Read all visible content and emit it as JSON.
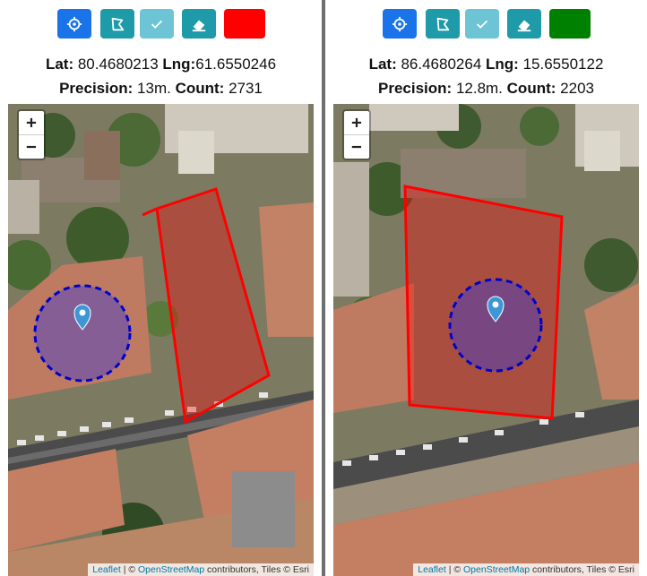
{
  "panels": [
    {
      "lat_label": "Lat:",
      "lat": "80.4680213",
      "lng_label": "Lng:",
      "lng": "61.6550246",
      "precision_label": "Precision:",
      "precision": "13m.",
      "count_label": "Count:",
      "count": "2731",
      "color_swatch": "#ff0000"
    },
    {
      "lat_label": "Lat:",
      "lat": "86.4680264",
      "lng_label": "Lng:",
      "lng": "15.6550122",
      "precision_label": "Precision:",
      "precision": "12.8m.",
      "count_label": "Count:",
      "count": "2203",
      "color_swatch": "#008000"
    }
  ],
  "toolbar": {
    "buttons": [
      {
        "icon": "crosshair-icon",
        "color": "#1a73e8"
      },
      {
        "icon": "polygon-draw-icon",
        "color": "#1e9aa8"
      },
      {
        "icon": "check-icon",
        "color": "#6cc4d4"
      },
      {
        "icon": "eraser-icon",
        "color": "#1e9aa8"
      }
    ]
  },
  "zoom": {
    "in": "+",
    "out": "−"
  },
  "attribution": {
    "leaflet": "Leaflet",
    "sep": " | © ",
    "osm": "OpenStreetMap",
    "rest": " contributors, Tiles © Esri"
  },
  "colors": {
    "polygon": "#ff0000",
    "precision_circle": "#0000cc",
    "marker": "#3d96d6"
  }
}
